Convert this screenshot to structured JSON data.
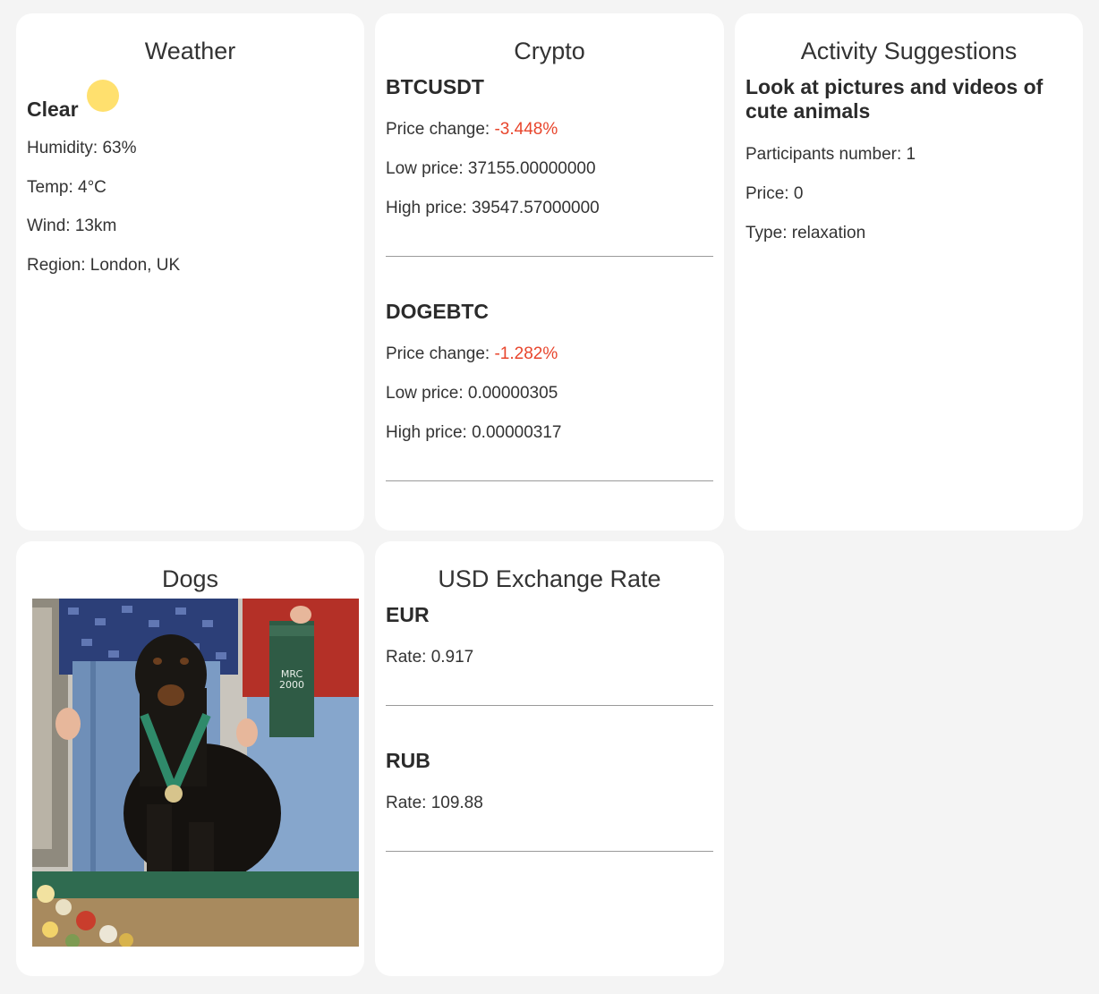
{
  "weather": {
    "title": "Weather",
    "condition": "Clear",
    "condition_icon": "sun-icon",
    "humidity": "Humidity: 63%",
    "temp": "Temp: 4°C",
    "wind": "Wind: 13km",
    "region": "Region: London, UK"
  },
  "crypto": {
    "title": "Crypto",
    "pairs": [
      {
        "symbol": "BTCUSDT",
        "price_change_label": "Price change: ",
        "price_change_value": "-3.448%",
        "low": "Low price: 37155.00000000",
        "high": "High price: 39547.57000000"
      },
      {
        "symbol": "DOGEBTC",
        "price_change_label": "Price change: ",
        "price_change_value": "-1.282%",
        "low": "Low price: 0.00000305",
        "high": "High price: 0.00000317"
      }
    ],
    "negative_color": "#e8452c"
  },
  "activity": {
    "title": "Activity Suggestions",
    "name": "Look at pictures and videos of cute animals",
    "participants": "Participants number: 1",
    "price": "Price: 0",
    "type": "Type: relaxation"
  },
  "dogs": {
    "title": "Dogs",
    "photo_text": "MRC 2000"
  },
  "exchange": {
    "title": "USD Exchange Rate",
    "rates": [
      {
        "currency": "EUR",
        "rate": "Rate: 0.917"
      },
      {
        "currency": "RUB",
        "rate": "Rate: 109.88"
      }
    ]
  }
}
